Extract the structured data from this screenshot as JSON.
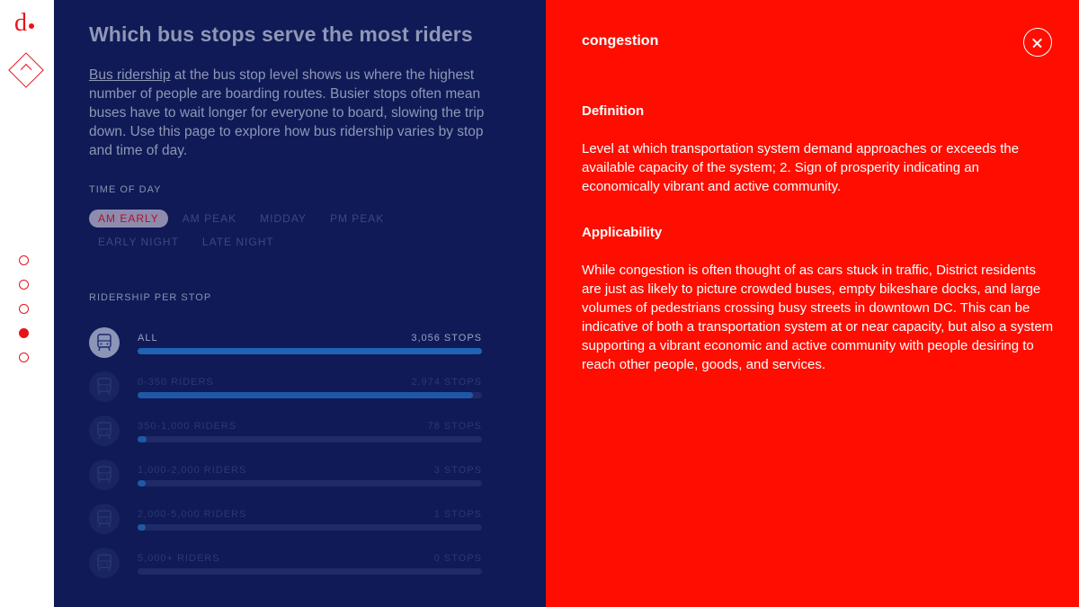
{
  "brand": {
    "logo_text": "d",
    "accent_color": "#e8131b"
  },
  "nav": {
    "up_icon": "chevron-up-icon",
    "pages": 5,
    "active_page": 4
  },
  "main": {
    "title": "Which bus stops serve the most riders",
    "intro_link": "Bus ridership",
    "intro_rest": " at the bus stop level shows us where the highest number of people are boarding routes. Busier stops often mean buses have to wait longer for everyone to board, slowing the trip down. Use this page to explore how bus ridership varies by stop and time of day.",
    "time_of_day_label": "TIME OF DAY",
    "time_of_day": [
      "AM EARLY",
      "AM PEAK",
      "MIDDAY",
      "PM PEAK",
      "EARLY NIGHT",
      "LATE NIGHT"
    ],
    "time_of_day_selected": "AM EARLY",
    "ridership_label": "RIDERSHIP PER STOP",
    "rows": [
      {
        "label": "ALL",
        "count": "3,056 STOPS",
        "share": 1.0
      },
      {
        "label": "0-350 RIDERS",
        "count": "2,974 STOPS",
        "share": 0.973
      },
      {
        "label": "350-1,000 RIDERS",
        "count": "78 STOPS",
        "share": 0.026
      },
      {
        "label": "1,000-2,000 RIDERS",
        "count": "3 STOPS",
        "share": 0.001
      },
      {
        "label": "2,000-5,000 RIDERS",
        "count": "1 STOPS",
        "share": 0.0003
      },
      {
        "label": "5,000+ RIDERS",
        "count": "0 STOPS",
        "share": 0.0
      }
    ]
  },
  "glossary": {
    "term": "congestion",
    "definition_heading": "Definition",
    "definition": "Level at which transportation system demand approaches or exceeds the available capacity of the system; 2. Sign of prosperity indicating an economically vibrant and active community.",
    "applicability_heading": "Applicability",
    "applicability": "While congestion is often thought of as cars stuck in traffic, District residents are just as likely to picture crowded buses, empty bikeshare docks, and large volumes of pedestrians crossing busy streets in downtown DC. This can be indicative of both a transportation system at or near capacity, but also a system supporting a vibrant economic and active community with people desiring to reach other people, goods, and services.",
    "close_icon": "close-icon",
    "background_color": "#ff0d00"
  }
}
